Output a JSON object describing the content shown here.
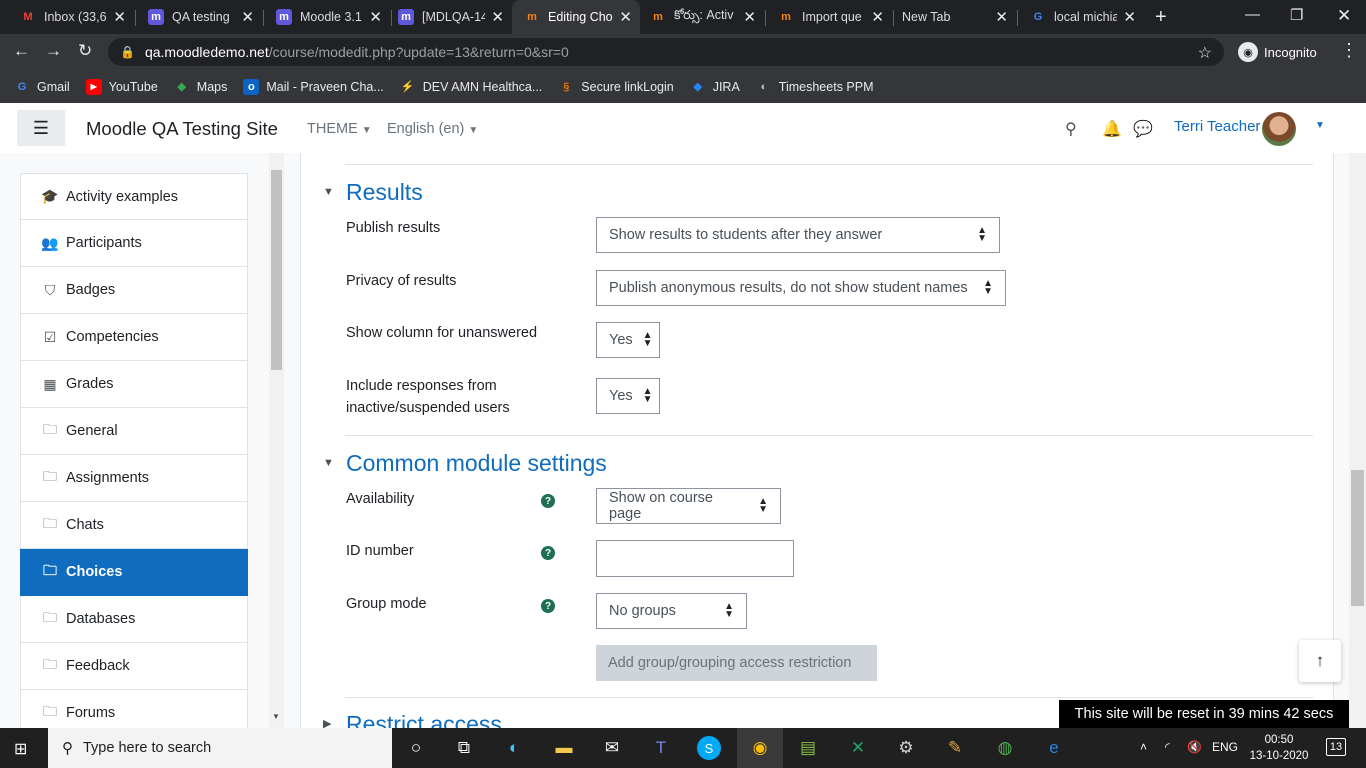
{
  "browser": {
    "tabs": [
      {
        "title": "Inbox (33,6",
        "favicon": "gmail-icon"
      },
      {
        "title": "QA testing",
        "favicon": "moodle-icon"
      },
      {
        "title": "Moodle 3.1",
        "favicon": "moodle-icon"
      },
      {
        "title": "[MDLQA-14",
        "favicon": "moodle-icon"
      },
      {
        "title": "Editing Cho",
        "favicon": "moodle-orange-icon",
        "active": true
      },
      {
        "title": "కోర్సు: Activ",
        "favicon": "moodle-orange-icon"
      },
      {
        "title": "Import que",
        "favicon": "moodle-orange-icon"
      },
      {
        "title": "New Tab",
        "favicon": ""
      },
      {
        "title": "local michia",
        "favicon": "google-icon"
      }
    ],
    "url_host": "qa.moodledemo.net",
    "url_path": "/course/modedit.php?update=13&return=0&sr=0",
    "incognito_label": "Incognito",
    "bookmarks": [
      {
        "label": "Gmail",
        "icon": "gmail-icon"
      },
      {
        "label": "YouTube",
        "icon": "youtube-icon"
      },
      {
        "label": "Maps",
        "icon": "maps-icon"
      },
      {
        "label": "Mail - Praveen Cha...",
        "icon": "outlook-icon"
      },
      {
        "label": "DEV AMN Healthca...",
        "icon": "amn-icon"
      },
      {
        "label": "Secure linkLogin",
        "icon": "link-icon"
      },
      {
        "label": "JIRA",
        "icon": "jira-icon"
      },
      {
        "label": "Timesheets PPM",
        "icon": "timesheet-icon"
      }
    ]
  },
  "header": {
    "site_name": "Moodle QA Testing Site",
    "theme_label": "THEME",
    "language_label": "English (en)",
    "user_name": "Terri Teacher"
  },
  "sidebar": {
    "items": [
      {
        "label": "Activity examples",
        "icon": "graduation-cap-icon"
      },
      {
        "label": "Participants",
        "icon": "users-icon"
      },
      {
        "label": "Badges",
        "icon": "shield-icon"
      },
      {
        "label": "Competencies",
        "icon": "check-square-icon"
      },
      {
        "label": "Grades",
        "icon": "table-icon"
      },
      {
        "label": "General",
        "icon": "folder-icon"
      },
      {
        "label": "Assignments",
        "icon": "folder-icon"
      },
      {
        "label": "Chats",
        "icon": "folder-icon"
      },
      {
        "label": "Choices",
        "icon": "folder-icon",
        "active": true
      },
      {
        "label": "Databases",
        "icon": "folder-icon"
      },
      {
        "label": "Feedback",
        "icon": "folder-icon"
      },
      {
        "label": "Forums",
        "icon": "folder-icon"
      }
    ]
  },
  "form": {
    "results": {
      "title": "Results",
      "publish_label": "Publish results",
      "publish_value": "Show results to students after they answer",
      "privacy_label": "Privacy of results",
      "privacy_value": "Publish anonymous results, do not show student names",
      "unanswered_label": "Show column for unanswered",
      "unanswered_value": "Yes",
      "inactive_label_1": "Include responses from",
      "inactive_label_2": "inactive/suspended users",
      "inactive_value": "Yes"
    },
    "common": {
      "title": "Common module settings",
      "availability_label": "Availability",
      "availability_value": "Show on course page",
      "idnumber_label": "ID number",
      "idnumber_value": "",
      "groupmode_label": "Group mode",
      "groupmode_value": "No groups",
      "restriction_button": "Add group/grouping access restriction"
    },
    "restrict": {
      "title": "Restrict access"
    }
  },
  "reset_notice": "This site will be reset in 39 mins 42 secs",
  "taskbar": {
    "search_placeholder": "Type here to search",
    "language": "ENG",
    "time": "00:50",
    "date": "13-10-2020",
    "notification_count": "13"
  }
}
